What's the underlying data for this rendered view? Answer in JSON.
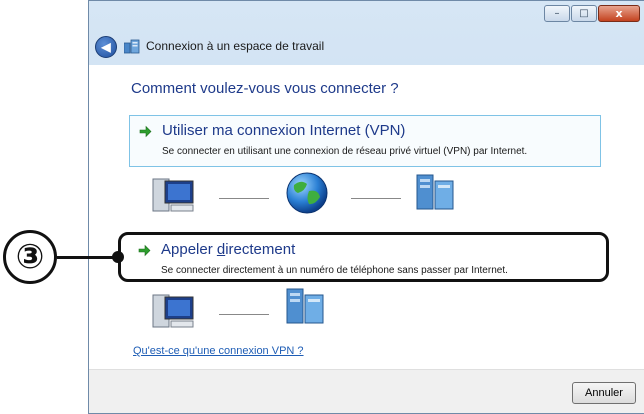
{
  "window": {
    "title": "Connexion à un espace de travail",
    "controls": {
      "minimize": "–",
      "maximize": "□",
      "close": "x"
    }
  },
  "heading": "Comment voulez-vous vous connecter ?",
  "options": [
    {
      "title": "Utiliser ma connexion Internet (VPN)",
      "description": "Se connecter en utilisant une connexion de réseau privé virtuel (VPN) par Internet."
    },
    {
      "title_pre": "Appeler ",
      "title_accel": "d",
      "title_post": "irectement",
      "description": "Se connecter directement à un numéro de téléphone sans passer par Internet."
    }
  ],
  "help_link": "Qu'est-ce qu'une connexion VPN ?",
  "cancel_label": "Annuler",
  "callout": {
    "number": "③"
  },
  "icons": {
    "back": "back-arrow-icon",
    "window": "network-workplace-icon",
    "option_arrow": "green-arrow-icon",
    "computer": "computer-icon",
    "globe": "globe-icon",
    "server": "server-icon"
  },
  "colors": {
    "link": "#1e3a8a",
    "option_border": "#7fc3e6",
    "arrow_green": "#2e9e2e"
  }
}
